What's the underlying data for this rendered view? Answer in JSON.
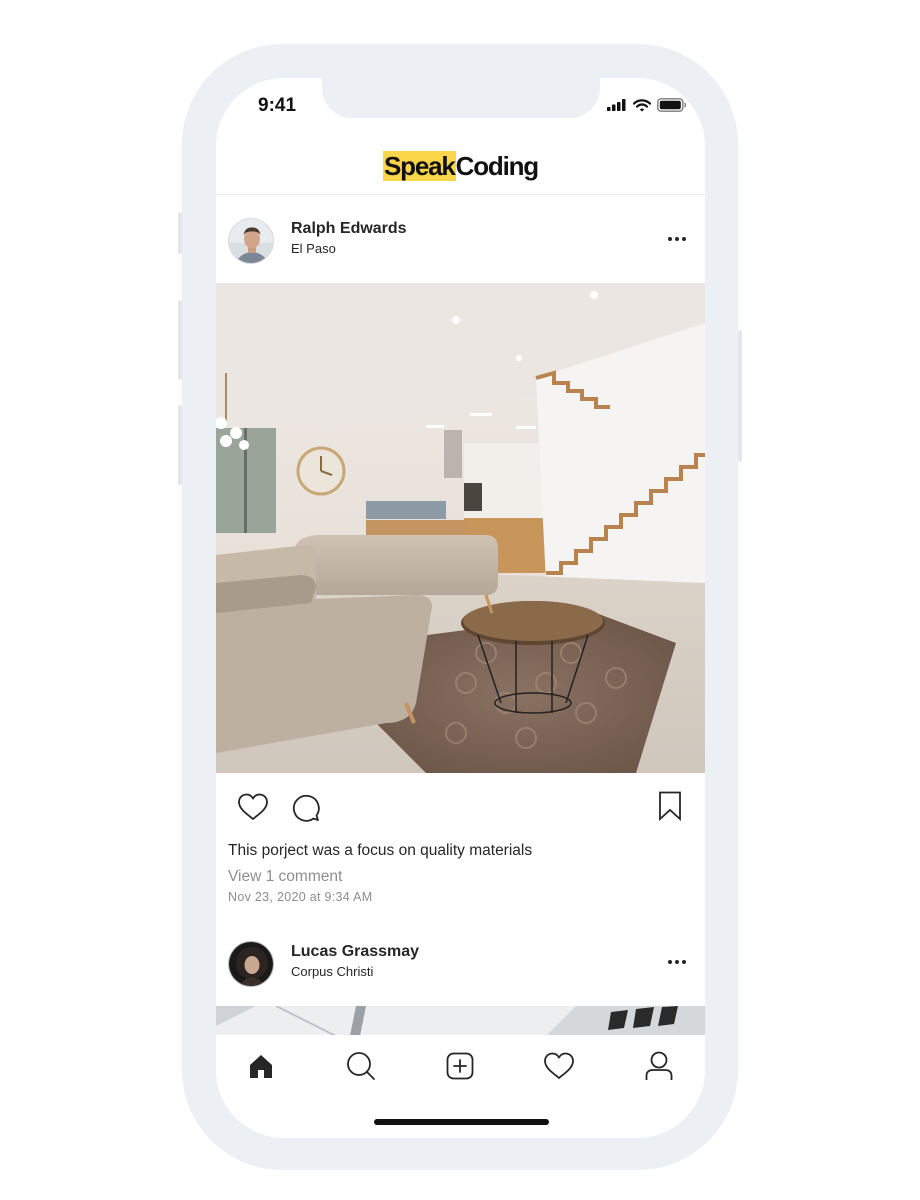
{
  "status_bar": {
    "time": "9:41"
  },
  "header": {
    "logo_highlight": "Speak",
    "logo_rest": "Coding",
    "highlight_color": "#fbd54a"
  },
  "posts": [
    {
      "user_name": "Ralph Edwards",
      "location": "El Paso",
      "more_icon": "more-horizontal-icon",
      "image_subject": "modern living room interior",
      "caption": "This porject was a focus on quality materials",
      "comments_link": "View 1 comment",
      "date": "Nov 23, 2020 at 9:34 AM",
      "actions": [
        "heart-icon",
        "comment-icon",
        "bookmark-icon"
      ]
    },
    {
      "user_name": "Lucas Grassmay",
      "location": "Corpus Christi",
      "more_icon": "more-horizontal-icon",
      "image_subject": "laptop keyboard"
    }
  ],
  "tab_bar": {
    "tabs": [
      "home-icon",
      "search-icon",
      "add-post-icon",
      "heart-icon",
      "profile-icon"
    ],
    "active": "home-icon"
  }
}
